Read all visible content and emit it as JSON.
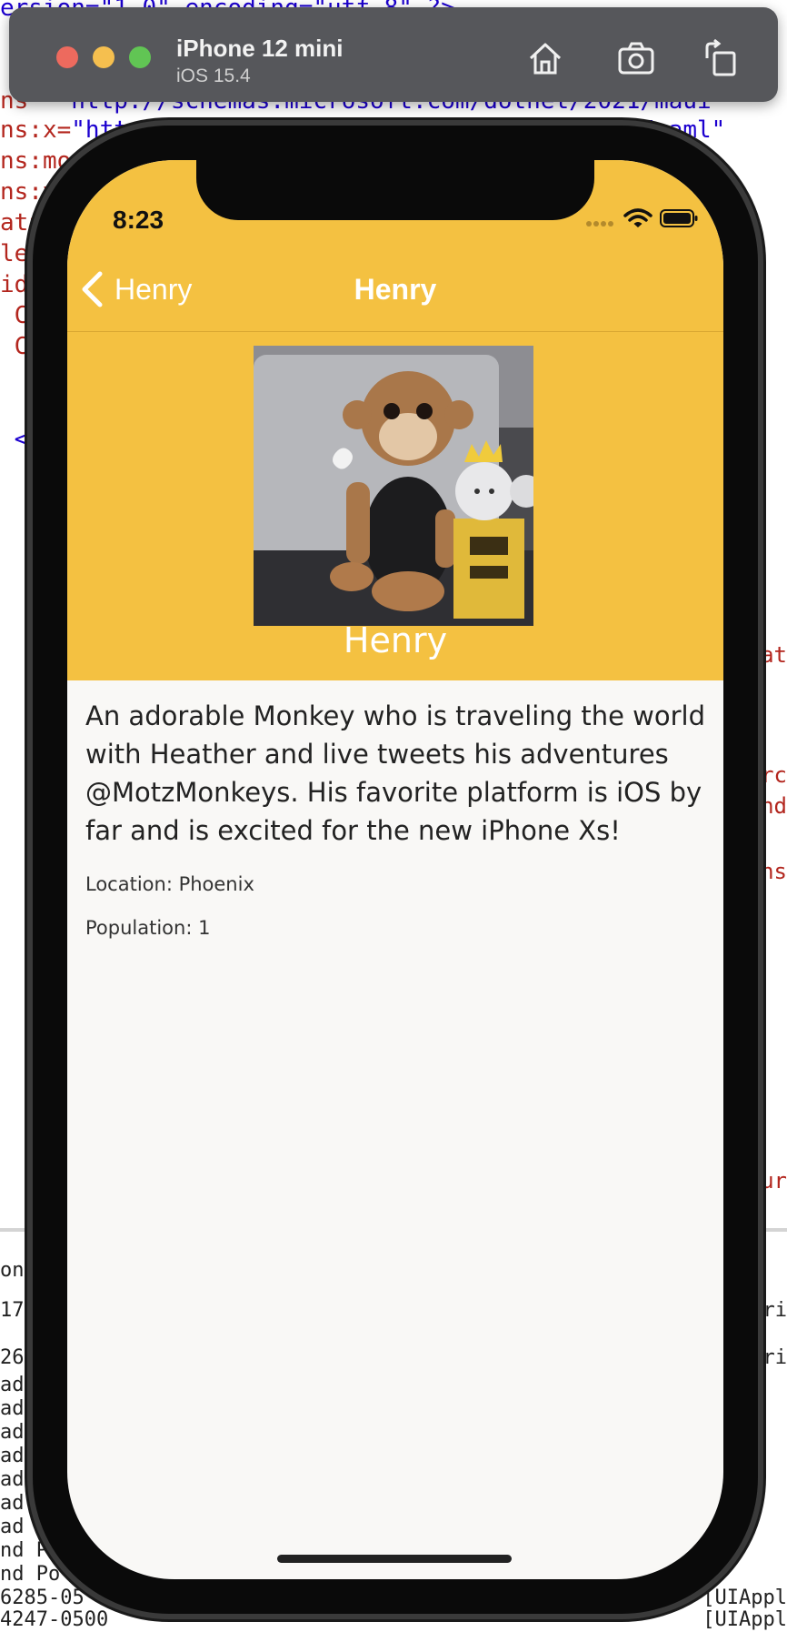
{
  "simulator": {
    "device_name": "iPhone 12 mini",
    "os_version": "iOS 15.4",
    "toolbar_icons": [
      "home-icon",
      "screenshot-icon",
      "rotate-icon"
    ]
  },
  "status_bar": {
    "time": "8:23"
  },
  "nav_bar": {
    "back_label": "Henry",
    "title": "Henry"
  },
  "monkey": {
    "name": "Henry",
    "description": "An adorable Monkey who is traveling the world with Heather and live tweets his adventures @MotzMonkeys. His favorite platform is iOS by far and is excited for the new iPhone Xs!",
    "location": "Location: Phoenix",
    "population": "Population: 1"
  },
  "colors": {
    "header": "#f4c141",
    "page_background": "#f9f8f6"
  }
}
